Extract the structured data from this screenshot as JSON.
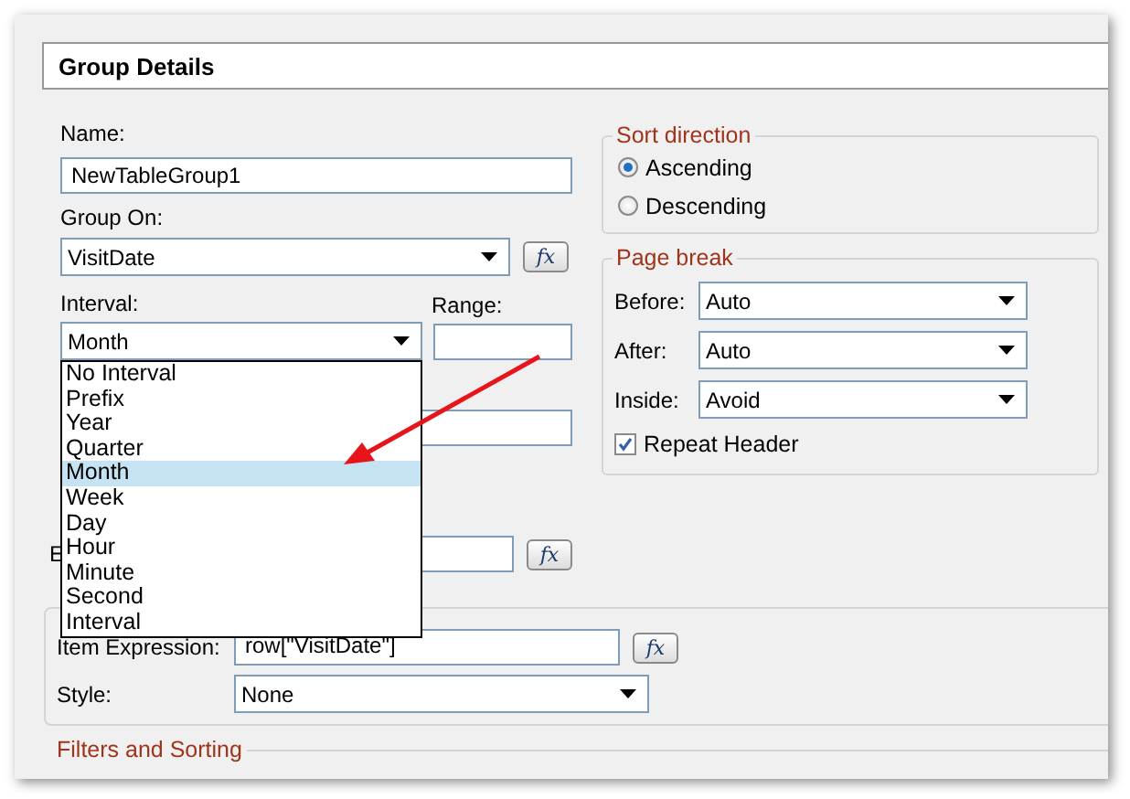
{
  "header": {
    "title": "Group Details"
  },
  "name": {
    "label": "Name:",
    "value": "NewTableGroup1"
  },
  "group_on": {
    "label": "Group On:",
    "value": "VisitDate",
    "formula_button": "fx"
  },
  "interval": {
    "label": "Interval:",
    "value": "Month",
    "options": [
      {
        "label": "No Interval",
        "selected": false
      },
      {
        "label": "Prefix",
        "selected": false
      },
      {
        "label": "Year",
        "selected": false
      },
      {
        "label": "Quarter",
        "selected": false
      },
      {
        "label": "Month",
        "selected": true
      },
      {
        "label": "Week",
        "selected": false
      },
      {
        "label": "Day",
        "selected": false
      },
      {
        "label": "Hour",
        "selected": false
      },
      {
        "label": "Minute",
        "selected": false
      },
      {
        "label": "Second",
        "selected": false
      },
      {
        "label": "Interval",
        "selected": false
      }
    ]
  },
  "range": {
    "label": "Range:"
  },
  "expression": {
    "label": "E",
    "formula_button": "fx"
  },
  "sort_direction": {
    "title": "Sort direction",
    "options": [
      {
        "label": "Ascending",
        "selected": true
      },
      {
        "label": "Descending",
        "selected": false
      }
    ]
  },
  "page_break": {
    "title": "Page break",
    "fields": [
      {
        "label": "Before:",
        "value": "Auto"
      },
      {
        "label": "After:",
        "value": "Auto"
      },
      {
        "label": "Inside:",
        "value": "Avoid"
      }
    ],
    "repeat_header": {
      "label": "Repeat Header",
      "checked": true
    }
  },
  "item": {
    "label": "Item Expression:",
    "value": "row[\"VisitDate\"]",
    "formula_button": "fx",
    "style_label": "Style:",
    "style_value": "None"
  },
  "filters_and_sorting": {
    "title": "Filters and Sorting"
  }
}
